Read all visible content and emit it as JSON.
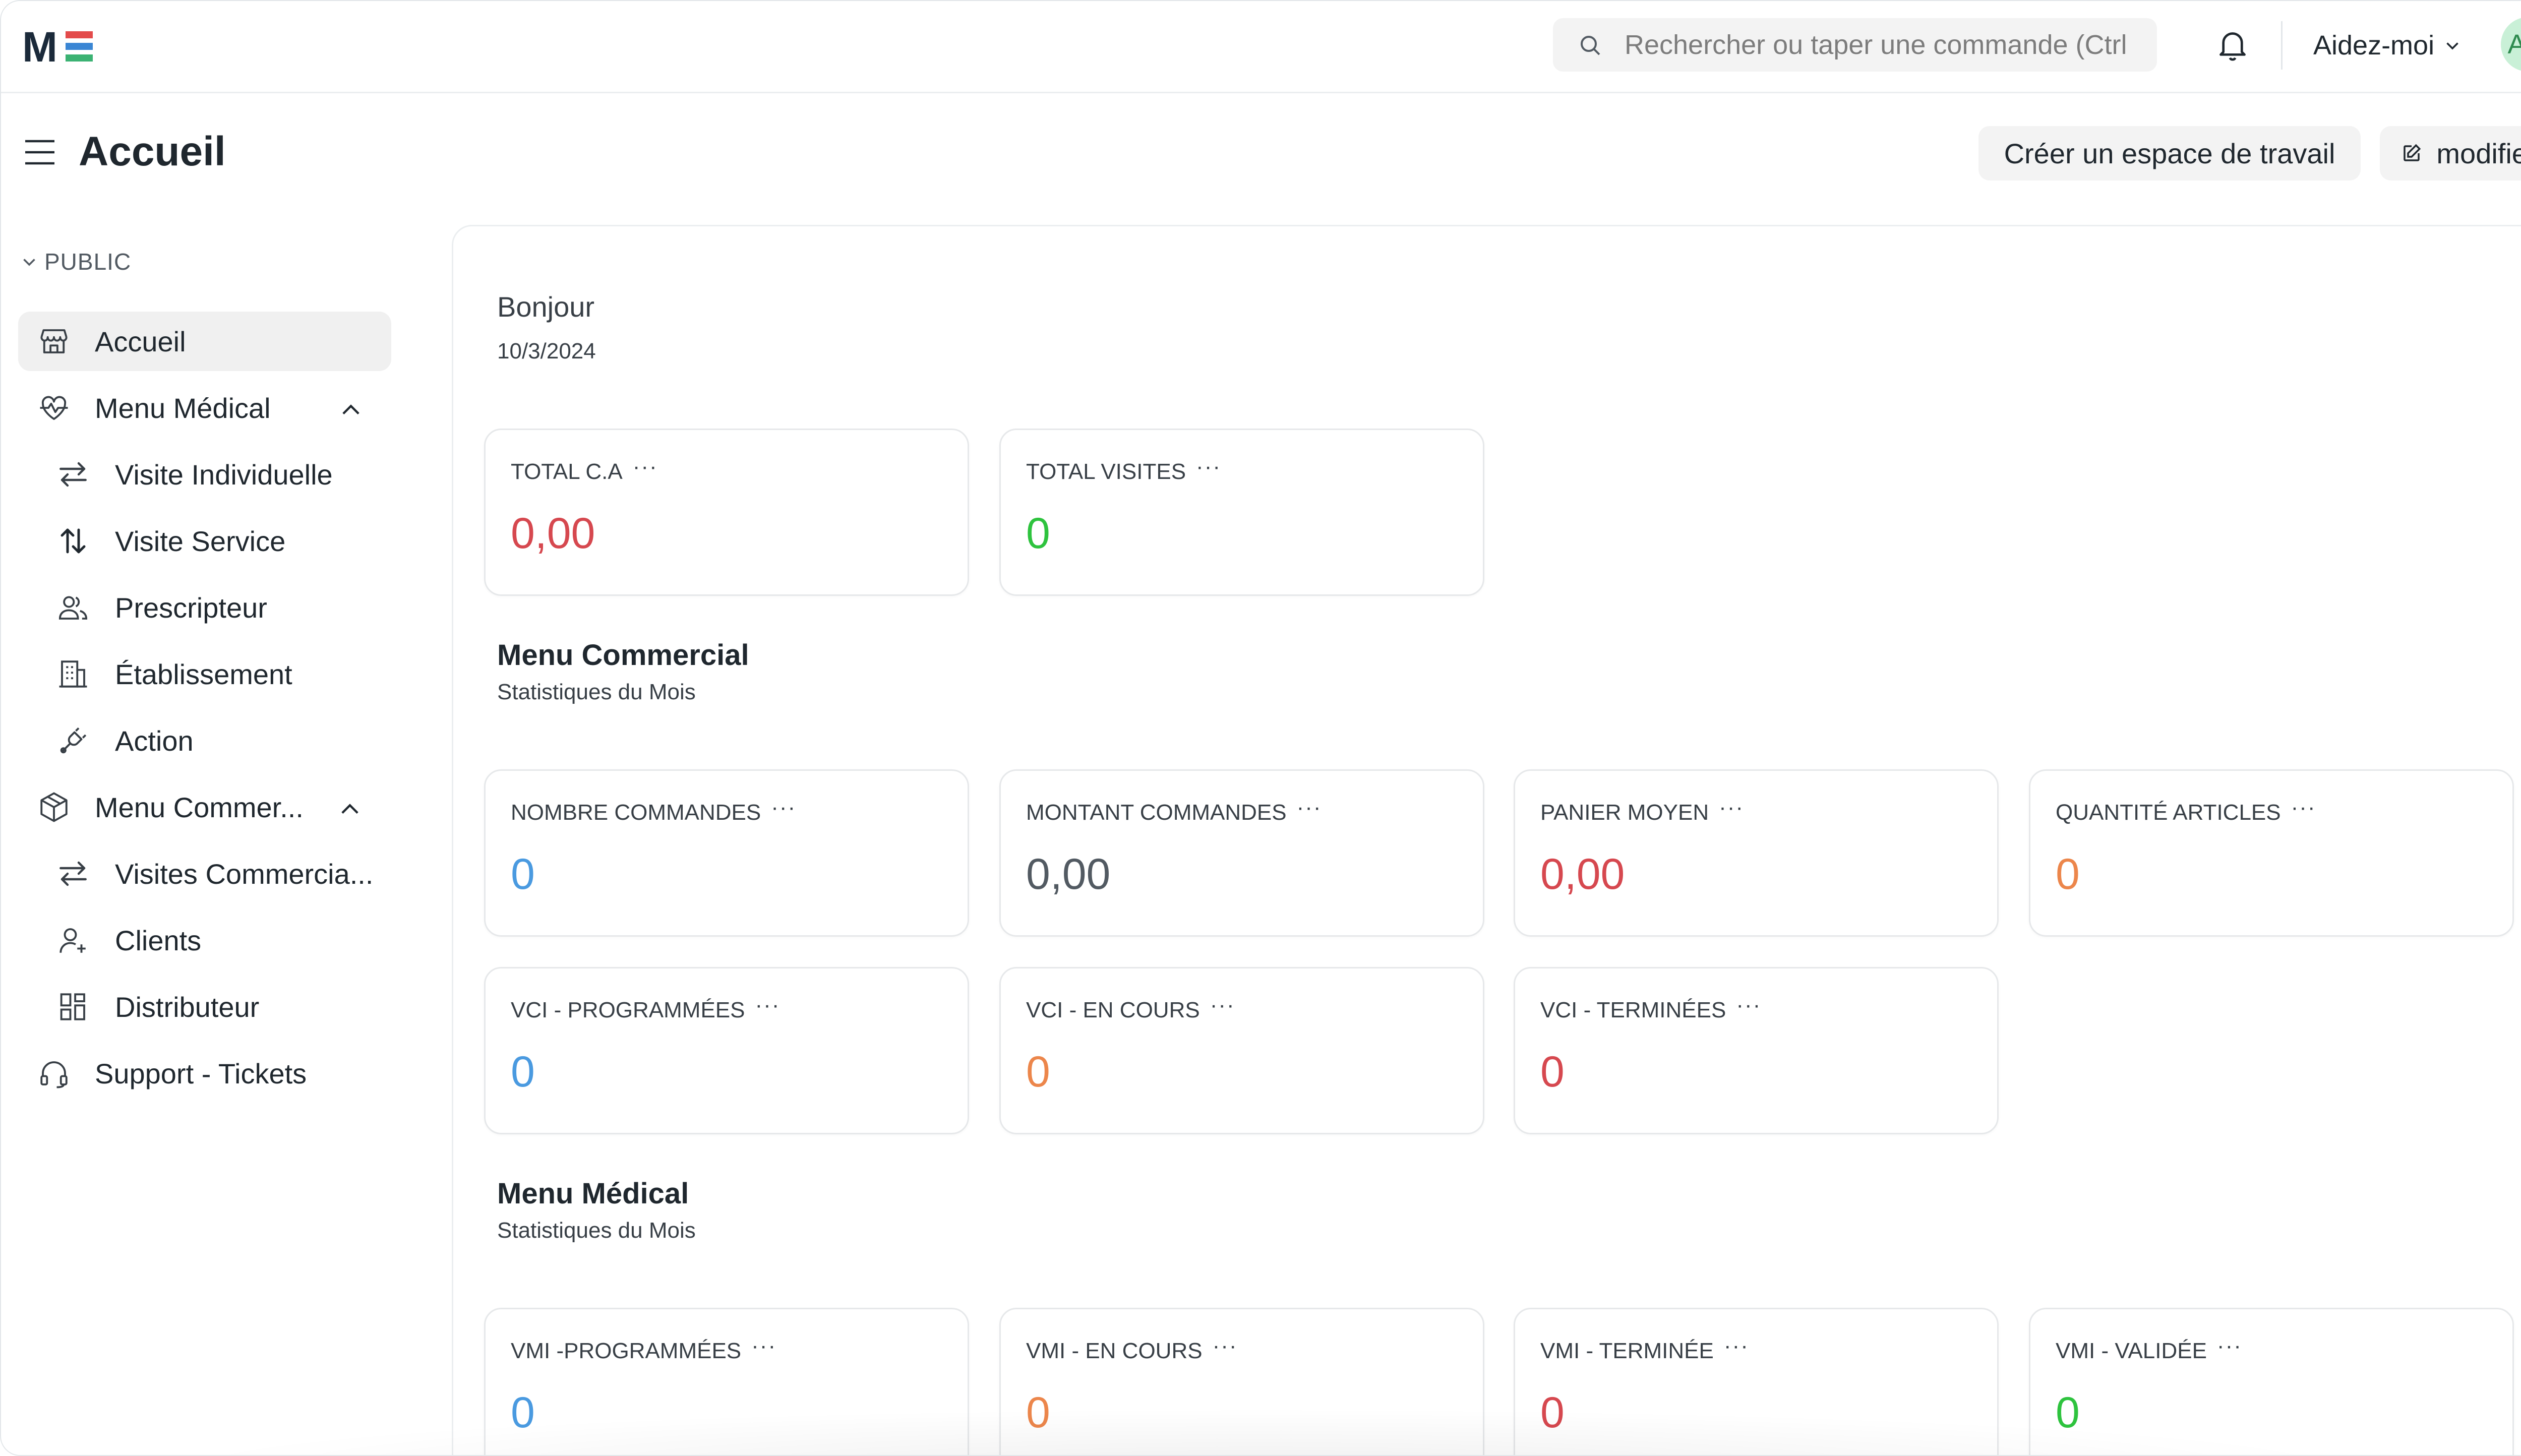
{
  "navbar": {
    "logo_text": "ME",
    "search_placeholder": "Rechercher ou taper une commande (Ctrl",
    "help_label": "Aidez-moi",
    "avatar_initials": "AM"
  },
  "page": {
    "title": "Accueil",
    "create_workspace_label": "Créer un espace de travail",
    "edit_label": "modifier"
  },
  "sidebar": {
    "section_label": "PUBLIC",
    "items": [
      {
        "label": "Accueil"
      },
      {
        "label": "Menu Médical"
      },
      {
        "label": "Visite Individuelle"
      },
      {
        "label": "Visite Service"
      },
      {
        "label": "Prescripteur"
      },
      {
        "label": "Établissement"
      },
      {
        "label": "Action"
      },
      {
        "label": "Menu Commer..."
      },
      {
        "label": "Visites Commercia..."
      },
      {
        "label": "Clients"
      },
      {
        "label": "Distributeur"
      },
      {
        "label": "Support - Tickets"
      }
    ]
  },
  "dashboard": {
    "greeting": "Bonjour",
    "date": "10/3/2024",
    "top_cards": [
      {
        "title": "TOTAL C.A",
        "value": "0,00"
      },
      {
        "title": "TOTAL VISITES",
        "value": "0"
      }
    ],
    "commercial": {
      "title": "Menu Commercial",
      "subtitle": "Statistiques du Mois",
      "cards": [
        {
          "title": "NOMBRE COMMANDES",
          "value": "0"
        },
        {
          "title": "MONTANT COMMANDES",
          "value": "0,00"
        },
        {
          "title": "PANIER MOYEN",
          "value": "0,00"
        },
        {
          "title": "QUANTITÉ ARTICLES",
          "value": "0"
        },
        {
          "title": "VCI - PROGRAMMÉES",
          "value": "0"
        },
        {
          "title": "VCI - EN COURS",
          "value": "0"
        },
        {
          "title": "VCI - TERMINÉES",
          "value": "0"
        }
      ]
    },
    "medical": {
      "title": "Menu Médical",
      "subtitle": "Statistiques du Mois",
      "cards": [
        {
          "title": "VMI -PROGRAMMÉES",
          "value": "0"
        },
        {
          "title": "VMI - EN COURS",
          "value": "0"
        },
        {
          "title": "VMI - TERMINÉE",
          "value": "0"
        },
        {
          "title": "VMI - VALIDÉE",
          "value": "0"
        }
      ]
    },
    "card_menu_glyph": "···"
  },
  "colors": {
    "red": "#d6484f",
    "green": "#2ec33e",
    "blue": "#4a9ae0",
    "orange": "#ec864b",
    "gray": "#525a62",
    "logo_dark": "#1b2a3a",
    "logo_red": "#e34b4b",
    "logo_blue": "#3a86d4",
    "logo_green": "#3bb273"
  }
}
